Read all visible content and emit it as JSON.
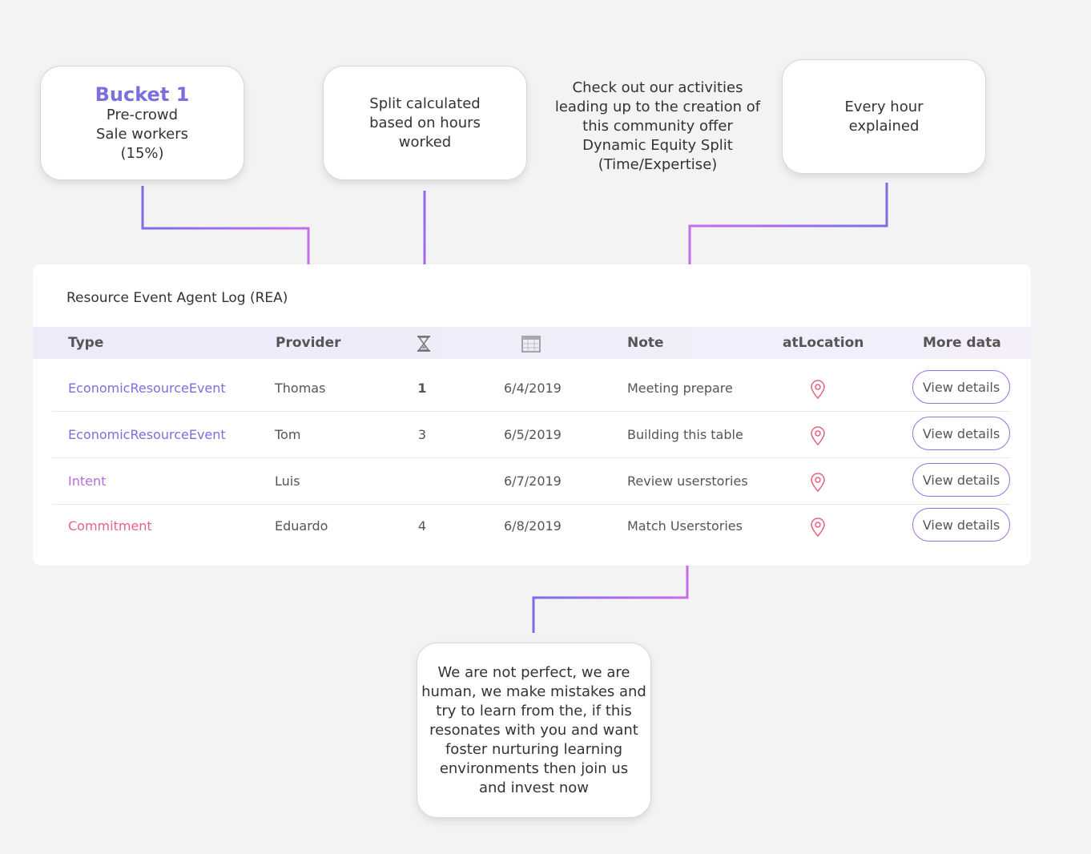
{
  "callouts": {
    "bucket": {
      "title": "Bucket 1",
      "lines": [
        "Pre-crowd",
        "Sale workers",
        "(15%)"
      ]
    },
    "split": {
      "lines": [
        "Split calculated",
        "based on hours",
        "worked"
      ]
    },
    "activities": {
      "lines": [
        "Check out our activities",
        "leading up to the creation of",
        "this community offer",
        "Dynamic Equity Split",
        "(Time/Expertise)"
      ]
    },
    "hours": {
      "lines": [
        "Every hour",
        "explained"
      ]
    },
    "perfect": {
      "lines": [
        "We are not perfect, we are",
        "human, we make mistakes and",
        "try to learn from the, if this",
        "resonates with you and want",
        "foster nurturing learning",
        "environments then join us",
        "and invest now"
      ]
    }
  },
  "table": {
    "title": "Resource Event Agent Log (REA)",
    "headers": {
      "type": "Type",
      "provider": "Provider",
      "hours_icon": "hourglass-icon",
      "date_icon": "calendar-icon",
      "note": "Note",
      "location": "atLocation",
      "more": "More data"
    },
    "rows": [
      {
        "type": "EconomicResourceEvent",
        "type_color": "#7b6fe0",
        "provider": "Thomas",
        "hours": "1",
        "date": "6/4/2019",
        "note": "Meeting prepare",
        "location_icon": "location-pin-icon",
        "action": "View details"
      },
      {
        "type": "EconomicResourceEvent",
        "type_color": "#7b6fe0",
        "provider": "Tom",
        "hours": "3",
        "date": "6/5/2019",
        "note": "Building this table",
        "location_icon": "location-pin-icon",
        "action": "View details"
      },
      {
        "type": "Intent",
        "type_color": "#b86be0",
        "provider": "Luis",
        "hours": "",
        "date": "6/7/2019",
        "note": "Review userstories",
        "location_icon": "location-pin-icon",
        "action": "View details"
      },
      {
        "type": "Commitment",
        "type_color": "#e8608f",
        "provider": "Eduardo",
        "hours": "4",
        "date": "6/8/2019",
        "note": "Match Userstories",
        "location_icon": "location-pin-icon",
        "action": "View details"
      }
    ]
  },
  "colors": {
    "accent_start": "#7b6fe0",
    "accent_end": "#c76ce8",
    "pin": "#e8607a"
  }
}
